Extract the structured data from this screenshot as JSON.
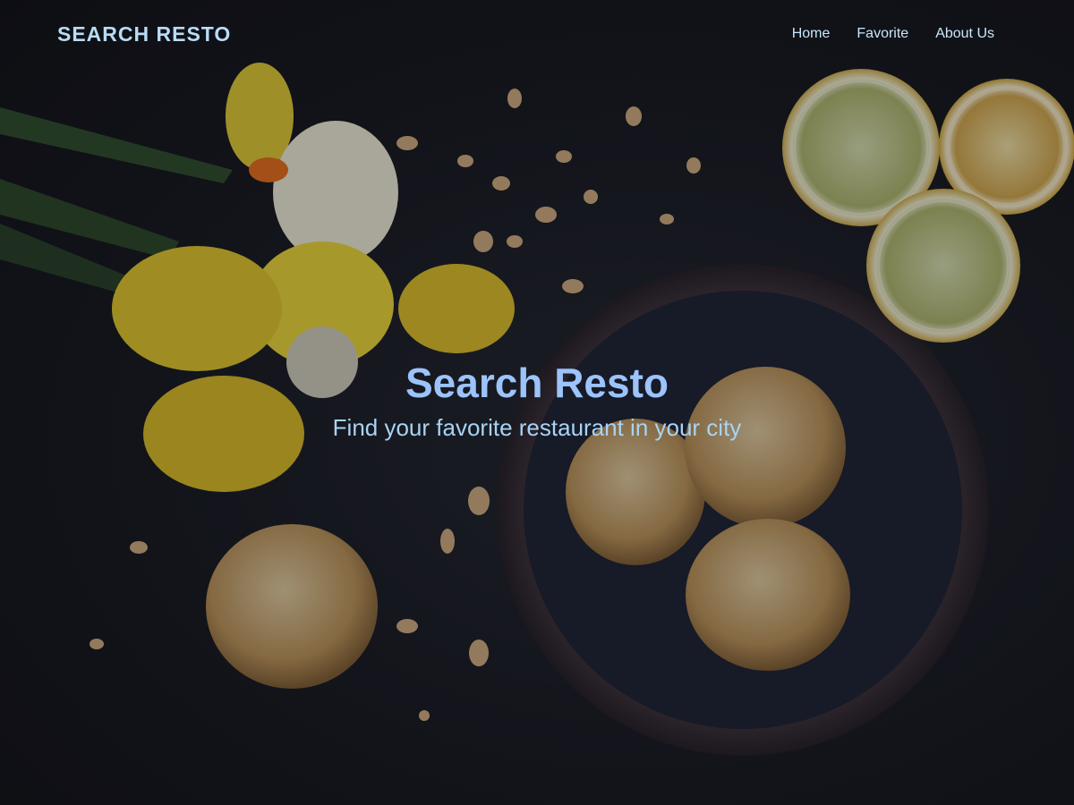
{
  "app": {
    "brand": "SEARCH RESTO"
  },
  "nav": {
    "items": [
      {
        "label": "Home"
      },
      {
        "label": "Favorite"
      },
      {
        "label": "About Us"
      }
    ]
  },
  "hero": {
    "title": "Search Resto",
    "subtitle": "Find your favorite restaurant in your city",
    "image_subject": "daffodils, lemon slices and almond cookies on a dark table"
  },
  "colors": {
    "brand": "#b8dcf6",
    "nav_text": "#c8e6fb",
    "hero_title": "#9cc3fb",
    "hero_subtitle": "#a9d3f4",
    "background": "#14161c"
  }
}
